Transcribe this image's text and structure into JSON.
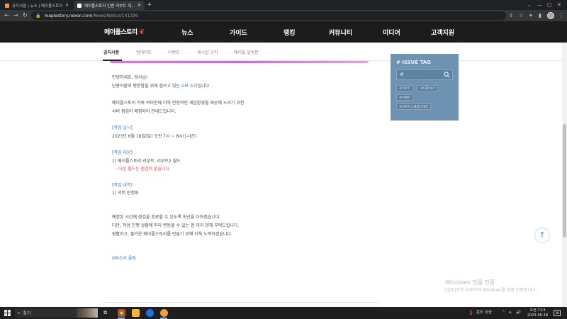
{
  "browser": {
    "tabs": [
      {
        "title": "공지사항 | 뉴스 | 메이플스토리",
        "favicon_color": "#f29a38"
      },
      {
        "title": "메이플스토리 인벤 리부트 게시판",
        "favicon_color": "#ffffff"
      }
    ],
    "url_host": "maplestory.nexon.com",
    "url_path": "/News/Notice/141336"
  },
  "site": {
    "logo": "메이플스토리",
    "nav": [
      "뉴스",
      "가이드",
      "랭킹",
      "커뮤니티",
      "미디어",
      "고객지원"
    ],
    "subnav": [
      "공지사항",
      "업데이트",
      "이벤트",
      "캐시샵 공지",
      "메이플 알림판"
    ],
    "subnav_active": 0
  },
  "article": {
    "greeting": "안녕하세요, 용사님!",
    "intro_prefix": "단풍아줌의 평온함을 위해 힘쓰고 있는 ",
    "intro_link": "GM 소리",
    "intro_suffix": "입니다.",
    "p2_line1": "메이플스토리 가족 여러분께 더욱 안정적인 게임환경을 제공해 드리기 위한",
    "p2_line2": "서버 점검이 예정되어 안내드립니다.",
    "sec1_heading": "[작업 일시]",
    "sec1_body": "2023년 6월 18일(일) 오전 7시 ~ 8시(1시간)",
    "sec2_heading": "[작업 대상]",
    "sec2_body": "1) 메이플스토리 리부트, 리부트2 월드",
    "sec2_note": "- 다른 월드는 점검이 없습니다.",
    "sec3_heading": "[작업 내역]",
    "sec3_body": "1) 서버 안정화",
    "closing1": "예정된 시간에 점검을 완료할 수 있도록 최선을 다하겠습니다.",
    "closing2": "다만, 작업 진행 상황에 따라 변동될 수 있는 점 미리 양해 부탁드립니다.",
    "closing3": "원활하고, 즐거운 메이플스토리를 만들기 위해 더욱 노력하겠습니다.",
    "signoff": "GM소리 올림"
  },
  "issue_tag": {
    "title": "# ISSUE TAG",
    "search_placeholder": "#",
    "chips": [
      "#리부트",
      "#디파이너",
      "#이벤트",
      "#리부트스페셜선데이"
    ]
  },
  "watermark": {
    "line1": "Windows 정품 인증",
    "line2": "[설정]으로 이동하여 Windows를 정품 인증합니다."
  },
  "taskbar": {
    "search_label": "찾기",
    "weather": "온도 상승",
    "time": "오전 7:13",
    "date": "2023-06-18",
    "notification_count": "26"
  }
}
